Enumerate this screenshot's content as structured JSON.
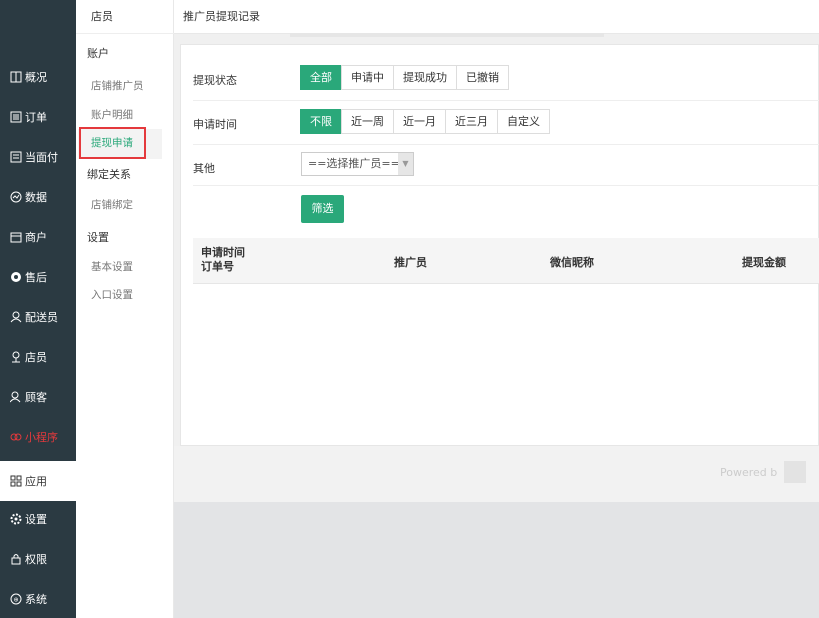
{
  "sidebar": {
    "items": [
      {
        "label": "概况",
        "icon": "dashboard-icon"
      },
      {
        "label": "订单",
        "icon": "order-icon"
      },
      {
        "label": "当面付",
        "icon": "pay-icon"
      },
      {
        "label": "数据",
        "icon": "data-icon"
      },
      {
        "label": "商户",
        "icon": "store-icon"
      },
      {
        "label": "售后",
        "icon": "aftersale-icon"
      },
      {
        "label": "配送员",
        "icon": "courier-icon"
      },
      {
        "label": "店员",
        "icon": "clerk-icon"
      },
      {
        "label": "顾客",
        "icon": "customer-icon"
      },
      {
        "label": "小程序",
        "icon": "miniprogram-icon"
      },
      {
        "label": "应用",
        "icon": "apps-icon"
      },
      {
        "label": "设置",
        "icon": "settings-icon"
      },
      {
        "label": "权限",
        "icon": "lock-icon"
      },
      {
        "label": "系统",
        "icon": "system-icon"
      }
    ]
  },
  "subnav": {
    "header": "店员",
    "group_account": "账户",
    "link_promoter": "店铺推广员",
    "link_detail": "账户明细",
    "link_withdraw": "提现申请",
    "group_binding": "绑定关系",
    "link_store_bind": "店铺绑定",
    "group_settings": "设置",
    "link_basic": "基本设置",
    "link_entry": "入口设置"
  },
  "page": {
    "title": "推广员提现记录"
  },
  "filters": {
    "status_label": "提现状态",
    "status_options": [
      "全部",
      "申请中",
      "提现成功",
      "已撤销"
    ],
    "time_label": "申请时间",
    "time_options": [
      "不限",
      "近一周",
      "近一月",
      "近三月",
      "自定义"
    ],
    "other_label": "其他",
    "promoter_select": "==选择推广员==",
    "filter_button": "筛选"
  },
  "table": {
    "col1_line1": "申请时间",
    "col1_line2": "订单号",
    "col2": "推广员",
    "col3": "微信昵称",
    "col4": "提现金额"
  },
  "footer": {
    "powered": "Powered b"
  },
  "colors": {
    "accent": "#2aa87a",
    "sidebar_bg": "#2b3a42",
    "highlight": "#e4393c"
  }
}
